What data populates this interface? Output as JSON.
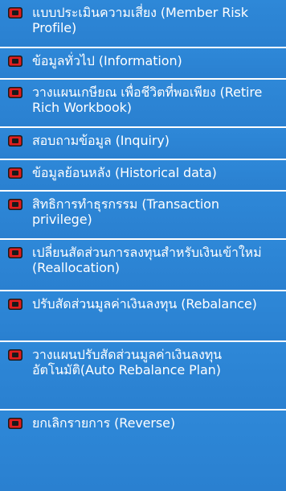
{
  "menu": {
    "items": [
      {
        "label": "แบบประเมินความเสี่ยง (Member Risk Profile)"
      },
      {
        "label": "ข้อมูลทั่วไป (Information)"
      },
      {
        "label": "วางแผนเกษียณ เพื่อชีวิตที่พอเพียง (Retire Rich Workbook)"
      },
      {
        "label": "สอบถามข้อมูล (Inquiry)"
      },
      {
        "label": "ข้อมูลย้อนหลัง (Historical data)"
      },
      {
        "label": "สิทธิการทำธุรกรรม (Transaction privilege)"
      },
      {
        "label": "เปลี่ยนสัดส่วนการลงทุนสำหรับเงินเข้าใหม่ (Reallocation)"
      },
      {
        "label": "ปรับสัดส่วนมูลค่าเงินลงทุน (Rebalance)"
      },
      {
        "label": "วางแผนปรับสัดส่วนมูลค่าเงินลงทุนอัตโนมัติ(Auto Rebalance Plan)"
      },
      {
        "label": "ยกเลิกรายการ (Reverse)"
      }
    ]
  },
  "colors": {
    "background": "#2a7fd0",
    "divider": "#ffffff",
    "bullet_red": "#e01e1e",
    "bullet_dark": "#1a1a1a"
  }
}
